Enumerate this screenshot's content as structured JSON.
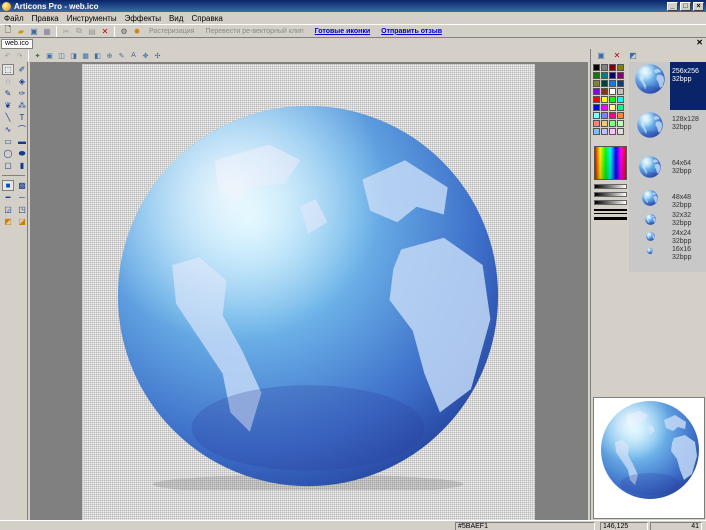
{
  "window": {
    "title": "Articons Pro - web.ico",
    "minimize": "_",
    "maximize": "□",
    "close": "×"
  },
  "menu": [
    "Файл",
    "Правка",
    "Инструменты",
    "Эффекты",
    "Вид",
    "Справка"
  ],
  "toolbar": {
    "rasterize": "Растеризация",
    "convert": "Перевести ре-векторный клип",
    "ready_icons": "Готовые иконки",
    "feedback": "Отправить отзыв"
  },
  "doc_tab": "web.ico",
  "formats": [
    {
      "size": "256x256",
      "bpp": "32bpp"
    },
    {
      "size": "128x128",
      "bpp": "32bpp"
    },
    {
      "size": "64x64",
      "bpp": "32bpp"
    },
    {
      "size": "48x48",
      "bpp": "32bpp"
    },
    {
      "size": "32x32",
      "bpp": "32bpp"
    },
    {
      "size": "24x24",
      "bpp": "32bpp"
    },
    {
      "size": "16x16",
      "bpp": "32bpp"
    }
  ],
  "status": {
    "color": "#5BAEF1",
    "coords": "146,125",
    "zoom": "41"
  },
  "colors": {
    "title_start": "#0a246a",
    "title_end": "#3a6ea5",
    "selection": "#0a246a",
    "link": "#0000cc"
  },
  "palette": [
    "#000000",
    "#808080",
    "#800000",
    "#808000",
    "#008000",
    "#008080",
    "#000080",
    "#800080",
    "#808040",
    "#004040",
    "#0080ff",
    "#004080",
    "#8000ff",
    "#804000",
    "#ffffff",
    "#c0c0c0",
    "#ff0000",
    "#ffff00",
    "#00ff00",
    "#00ffff",
    "#0000ff",
    "#ff00ff",
    "#ffff80",
    "#00ff80",
    "#80ffff",
    "#8080ff",
    "#ff0080",
    "#ff8040",
    "#ff8080",
    "#ffc080",
    "#80ff80",
    "#c0ffc0",
    "#80c0ff",
    "#c0c0ff",
    "#ffc0ff",
    "#e0e0e0"
  ]
}
